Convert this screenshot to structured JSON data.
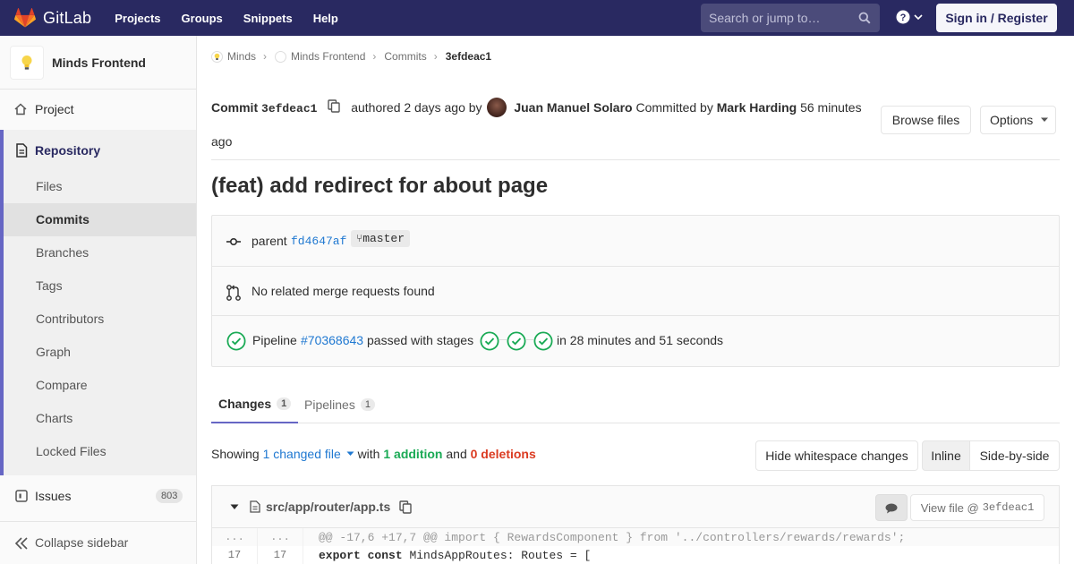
{
  "topnav": {
    "brand": "GitLab",
    "links": [
      "Projects",
      "Groups",
      "Snippets",
      "Help"
    ],
    "search_placeholder": "Search or jump to…",
    "signin": "Sign in / Register"
  },
  "sidebar": {
    "project_name": "Minds Frontend",
    "project": "Project",
    "repository": "Repository",
    "sub_items": [
      "Files",
      "Commits",
      "Branches",
      "Tags",
      "Contributors",
      "Graph",
      "Compare",
      "Charts",
      "Locked Files"
    ],
    "active_sub": "Commits",
    "issues": "Issues",
    "issues_count": "803",
    "collapse": "Collapse sidebar"
  },
  "breadcrumb": [
    "Minds",
    "Minds Frontend",
    "Commits",
    "3efdeac1"
  ],
  "commit": {
    "label": "Commit",
    "sha": "3efdeac1",
    "authored": "authored 2 days ago by",
    "author": "Juan Manuel Solaro",
    "committed_by_label": "Committed by",
    "committer": "Mark Harding",
    "committed_time": "56 minutes ago",
    "browse_files": "Browse files",
    "options": "Options",
    "title": "(feat) add redirect for about page"
  },
  "info": {
    "parent_label": "parent",
    "parent_sha": "fd4647af",
    "branch": "master",
    "merge_requests": "No related merge requests found",
    "pipeline_label": "Pipeline",
    "pipeline_id": "#70368643",
    "pipeline_status": "passed with stages",
    "pipeline_duration": "in 28 minutes and 51 seconds"
  },
  "tabs": [
    {
      "label": "Changes",
      "count": "1"
    },
    {
      "label": "Pipelines",
      "count": "1"
    }
  ],
  "stats": {
    "showing": "Showing",
    "changed": "1 changed file",
    "with": "with",
    "additions": "1 addition",
    "and": "and",
    "deletions": "0 deletions"
  },
  "view_buttons": {
    "hide_whitespace": "Hide whitespace changes",
    "inline": "Inline",
    "side_by_side": "Side-by-side"
  },
  "file": {
    "path": "src/app/router/app.ts",
    "view_file": "View file @",
    "view_sha": "3efdeac1",
    "hunk_old": "...",
    "hunk_new": "...",
    "hunk": "@@ -17,6 +17,7 @@ import { RewardsComponent } from '../controllers/rewards/rewards';",
    "line_old": "17",
    "line_new": "17",
    "line_kw": "export const",
    "line_rest": "MindsAppRoutes: Routes = ["
  },
  "colors": {
    "nav_bg": "#292961",
    "accent": "#6666c4",
    "link": "#1f78d1",
    "success": "#1aaa55",
    "danger": "#db3b21"
  }
}
